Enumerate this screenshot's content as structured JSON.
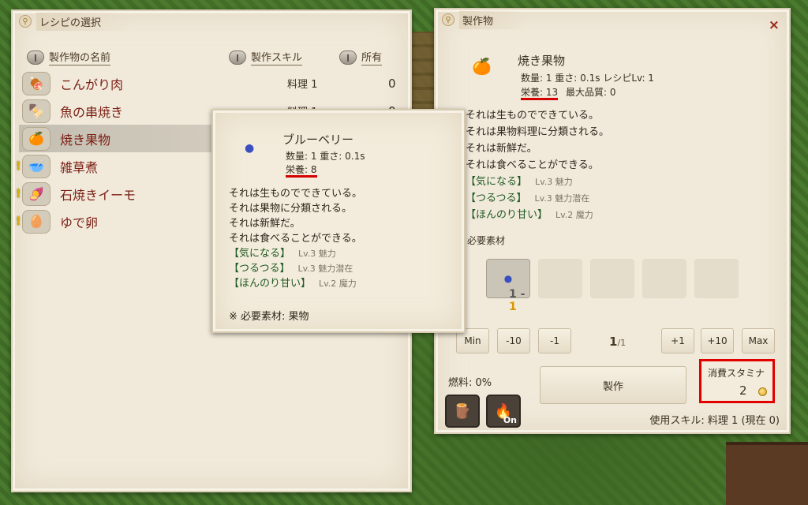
{
  "recipe_panel": {
    "title": "レシピの選択",
    "columns": {
      "name": "製作物の名前",
      "skill": "製作スキル",
      "owned": "所有"
    },
    "rows": [
      {
        "name": "こんがり肉",
        "skill": "料理 1",
        "owned": "0",
        "icon": "meat-icon",
        "warning": false,
        "selected": false
      },
      {
        "name": "魚の串焼き",
        "skill": "料理 1",
        "owned": "0",
        "icon": "fish-skewer-icon",
        "warning": false,
        "selected": false
      },
      {
        "name": "焼き果物",
        "skill": "",
        "owned": "",
        "icon": "baked-fruit-icon",
        "warning": false,
        "selected": true
      },
      {
        "name": "雑草煮",
        "skill": "",
        "owned": "",
        "icon": "weed-stew-icon",
        "warning": true,
        "selected": false
      },
      {
        "name": "石焼きイーモ",
        "skill": "",
        "owned": "",
        "icon": "roasted-potato-icon",
        "warning": true,
        "selected": false
      },
      {
        "name": "ゆで卵",
        "skill": "",
        "owned": "",
        "icon": "boiled-egg-icon",
        "warning": true,
        "selected": false
      }
    ]
  },
  "tooltip": {
    "name": "ブルーベリー",
    "stat_line1": "数量: 1  重さ: 0.1s",
    "nutrition": "栄養: 8",
    "desc": [
      "それは生ものでできている。",
      "それは果物に分類される。",
      "それは新鮮だ。",
      "それは食べることができる。"
    ],
    "traits": [
      {
        "name": "【気になる】",
        "lv": "Lv.3 魅力"
      },
      {
        "name": "【つるつる】",
        "lv": "Lv.3 魅力潜在"
      },
      {
        "name": "【ほんのり甘い】",
        "lv": "Lv.2 魔力"
      }
    ],
    "material": "※ 必要素材: 果物"
  },
  "craft_panel": {
    "title": "製作物",
    "close": "×",
    "item_name": "焼き果物",
    "stat_line1": "数量: 1  重さ: 0.1s  レシピLv: 1",
    "nutrition": "栄養: 13",
    "max_quality": "最大品質: 0",
    "desc": [
      "それは生ものでできている。",
      "それは果物料理に分類される。",
      "それは新鮮だ。",
      "それは食べることができる。"
    ],
    "traits": [
      {
        "name": "【気になる】",
        "lv": "Lv.3 魅力"
      },
      {
        "name": "【つるつる】",
        "lv": "Lv.3 魅力潜在"
      },
      {
        "name": "【ほんのり甘い】",
        "lv": "Lv.2 魔力"
      }
    ],
    "required_label": "必要素材",
    "slot_count_a": "1",
    "slot_count_sep": " - ",
    "slot_count_b": "1",
    "buttons": {
      "min": "Min",
      "minus10": "-10",
      "minus1": "-1",
      "plus1": "+1",
      "plus10": "+10",
      "max": "Max"
    },
    "quantity": "1",
    "quantity_max": "/1",
    "fuel": "燃料: 0%",
    "craft": "製作",
    "toggle": "On",
    "stamina_label": "消費スタミナ",
    "stamina_value": "2",
    "skill_line": "使用スキル: 料理 1 (現在 0)"
  }
}
